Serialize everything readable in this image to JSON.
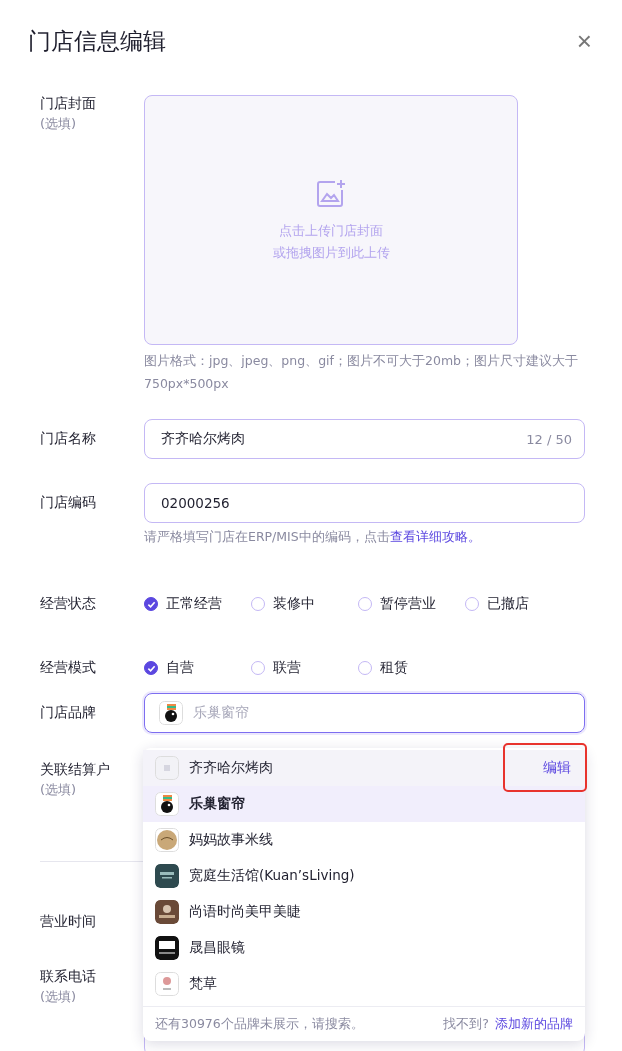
{
  "dialog": {
    "title": "门店信息编辑",
    "close": "×"
  },
  "cover": {
    "label": "门店封面",
    "optional": "(选填)",
    "upload_line1": "点击上传门店封面",
    "upload_line2": "或拖拽图片到此上传",
    "hint": "图片格式：jpg、jpeg、png、gif；图片不可大于20mb；图片尺寸建议大于750px*500px"
  },
  "store_name": {
    "label": "门店名称",
    "value": "齐齐哈尔烤肉",
    "count": "12 / 50"
  },
  "store_code": {
    "label": "门店编码",
    "value": "02000256",
    "hint": "请严格填写门店在ERP/MIS中的编码，点击",
    "link": "查看详细攻略。"
  },
  "status": {
    "label": "经营状态",
    "options": [
      {
        "label": "正常经营",
        "selected": true
      },
      {
        "label": "装修中",
        "selected": false
      },
      {
        "label": "暂停营业",
        "selected": false
      },
      {
        "label": "已撤店",
        "selected": false
      }
    ]
  },
  "mode": {
    "label": "经营模式",
    "options": [
      {
        "label": "自营",
        "selected": true
      },
      {
        "label": "联营",
        "selected": false
      },
      {
        "label": "租赁",
        "selected": false
      }
    ]
  },
  "brand": {
    "label": "门店品牌",
    "placeholder": "乐巢窗帘"
  },
  "account": {
    "label": "关联结算户",
    "optional": "(选填)"
  },
  "hours": {
    "label": "营业时间"
  },
  "phone": {
    "label": "联系电话",
    "optional": "(选填)"
  },
  "dropdown": {
    "items": [
      {
        "name": "齐齐哈尔烤肉",
        "kind": "blank",
        "hovered": true,
        "selected": false,
        "action": "编辑",
        "highlighted": true
      },
      {
        "name": "乐巢窗帘",
        "kind": "bird",
        "hovered": false,
        "selected": true
      },
      {
        "name": "妈妈故事米线",
        "kind": "round",
        "hovered": false,
        "selected": false
      },
      {
        "name": "宽庭生活馆(Kuan’sLiving)",
        "kind": "teal",
        "hovered": false,
        "selected": false
      },
      {
        "name": "尚语时尚美甲美睫",
        "kind": "brown",
        "hovered": false,
        "selected": false
      },
      {
        "name": "晟昌眼镜",
        "kind": "black",
        "hovered": false,
        "selected": false
      },
      {
        "name": "梵草",
        "kind": "flower",
        "hovered": false,
        "selected": false
      }
    ],
    "footer_note": "还有30976个品牌未展示，请搜索。",
    "footer_question": "找不到?",
    "footer_link": "添加新的品牌"
  }
}
